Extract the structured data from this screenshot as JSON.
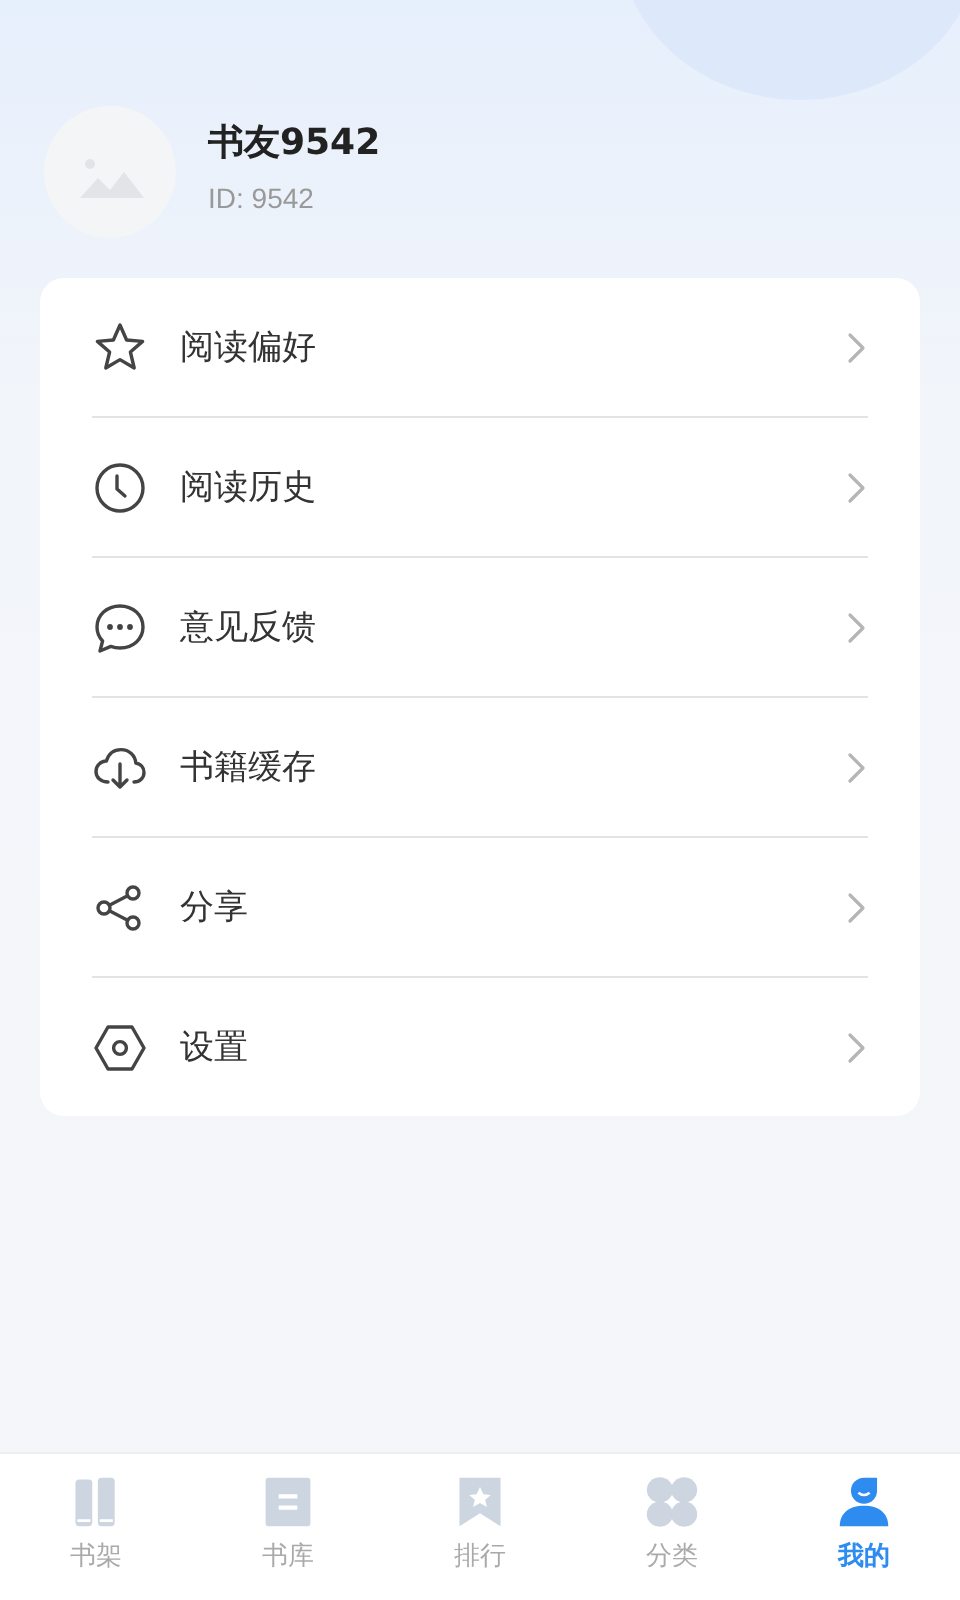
{
  "profile": {
    "name": "书友9542",
    "id_label": "ID: 9542"
  },
  "menu": [
    {
      "kind": "star",
      "label": "阅读偏好"
    },
    {
      "kind": "clock",
      "label": "阅读历史"
    },
    {
      "kind": "chat",
      "label": "意见反馈"
    },
    {
      "kind": "cloud",
      "label": "书籍缓存"
    },
    {
      "kind": "share",
      "label": "分享"
    },
    {
      "kind": "settings",
      "label": "设置"
    }
  ],
  "tabs": [
    {
      "kind": "shelf",
      "label": "书架",
      "selected": false
    },
    {
      "kind": "library",
      "label": "书库",
      "selected": false
    },
    {
      "kind": "rank",
      "label": "排行",
      "selected": false
    },
    {
      "kind": "category",
      "label": "分类",
      "selected": false
    },
    {
      "kind": "profile",
      "label": "我的",
      "selected": true
    }
  ]
}
